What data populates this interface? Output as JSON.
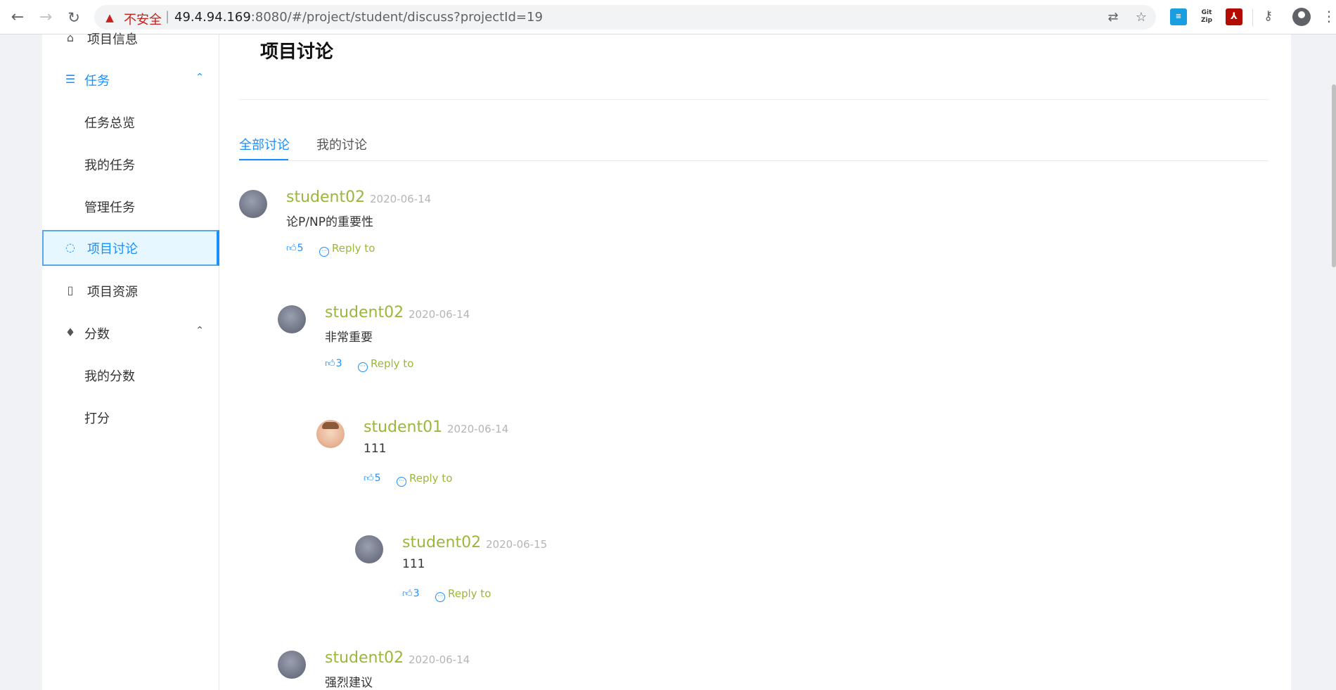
{
  "browser": {
    "security_label": "不安全",
    "separator": "|",
    "url_host": "49.4.94.169",
    "url_rest": ":8080/#/project/student/discuss?projectId=19",
    "ext_git_label": "Git Zip"
  },
  "sidebar": {
    "items": [
      {
        "label": "项目信息",
        "icon": "home-icon"
      },
      {
        "label": "任务",
        "icon": "list-icon"
      },
      {
        "label": "任务总览"
      },
      {
        "label": "我的任务"
      },
      {
        "label": "管理任务"
      },
      {
        "label": "项目讨论",
        "icon": "chat-icon"
      },
      {
        "label": "项目资源",
        "icon": "file-icon"
      },
      {
        "label": "分数",
        "icon": "rocket-icon"
      },
      {
        "label": "我的分数"
      },
      {
        "label": "打分"
      }
    ]
  },
  "main": {
    "title": "项目讨论",
    "tabs": [
      {
        "label": "全部讨论"
      },
      {
        "label": "我的讨论"
      }
    ],
    "comments": [
      {
        "user": "student02",
        "date": "2020-06-14",
        "text": "论P/NP的重要性",
        "likes": "5",
        "reply": "Reply to"
      },
      {
        "user": "student02",
        "date": "2020-06-14",
        "text": "非常重要",
        "likes": "3",
        "reply": "Reply to"
      },
      {
        "user": "student01",
        "date": "2020-06-14",
        "text": "111",
        "likes": "5",
        "reply": "Reply to"
      },
      {
        "user": "student02",
        "date": "2020-06-15",
        "text": "111",
        "likes": "3",
        "reply": "Reply to"
      },
      {
        "user": "student02",
        "date": "2020-06-14",
        "text": "强烈建议",
        "likes": "",
        "reply": ""
      }
    ]
  },
  "colors": {
    "accent": "#1890ff",
    "username": "#9ab73a",
    "insecure": "#c5221f"
  }
}
